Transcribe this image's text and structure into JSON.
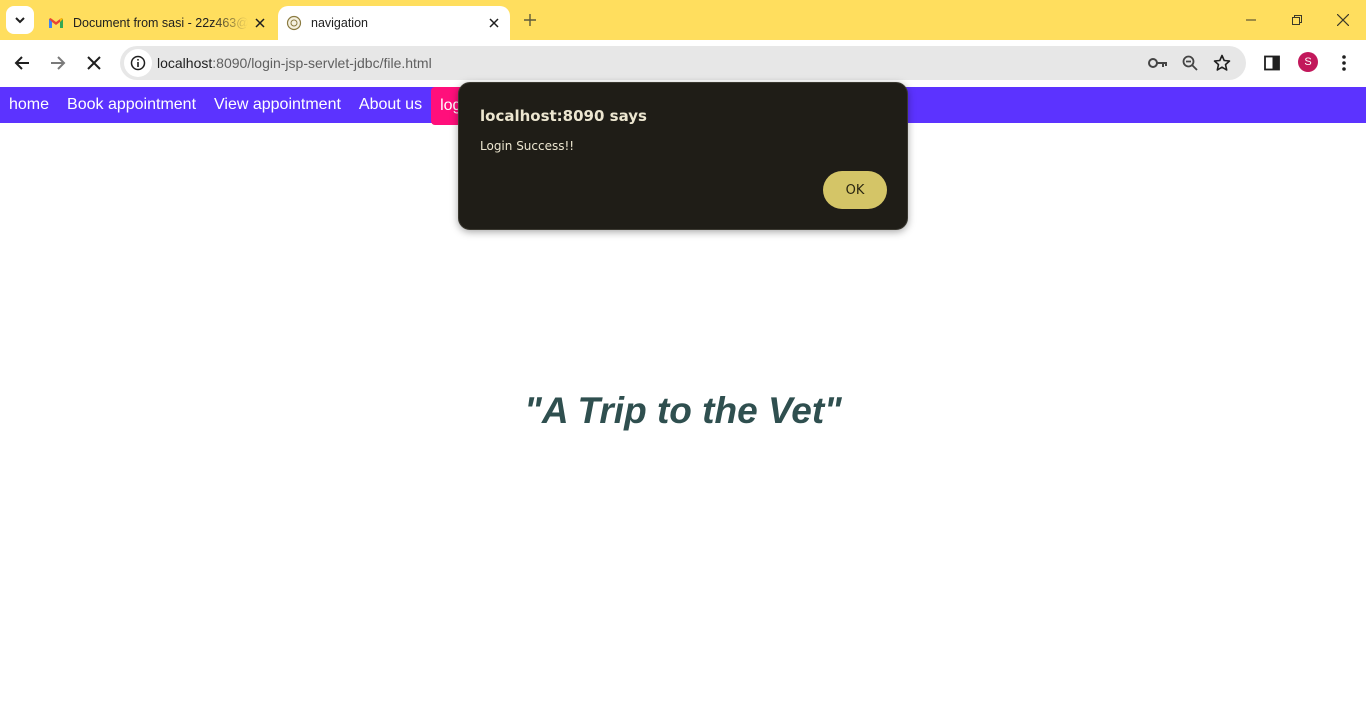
{
  "browser": {
    "tabs": [
      {
        "title": "Document from sasi - 22z463@",
        "favicon": "gmail-icon"
      },
      {
        "title": "navigation",
        "favicon": "site-icon"
      }
    ],
    "url_host": "localhost",
    "url_rest": ":8090/login-jsp-servlet-jdbc/file.html",
    "profile_initial": "S",
    "accent": "#ffde5e"
  },
  "nav": {
    "items": [
      "home",
      "Book appointment",
      "View appointment",
      "About us",
      "login"
    ],
    "bg_color": "#5c33ff",
    "active_color": "#ff0f7b"
  },
  "main": {
    "quote": "\"A Trip to the Vet\""
  },
  "dialog": {
    "title": "localhost:8090 says",
    "message": "Login Success!!",
    "ok_label": "OK"
  }
}
